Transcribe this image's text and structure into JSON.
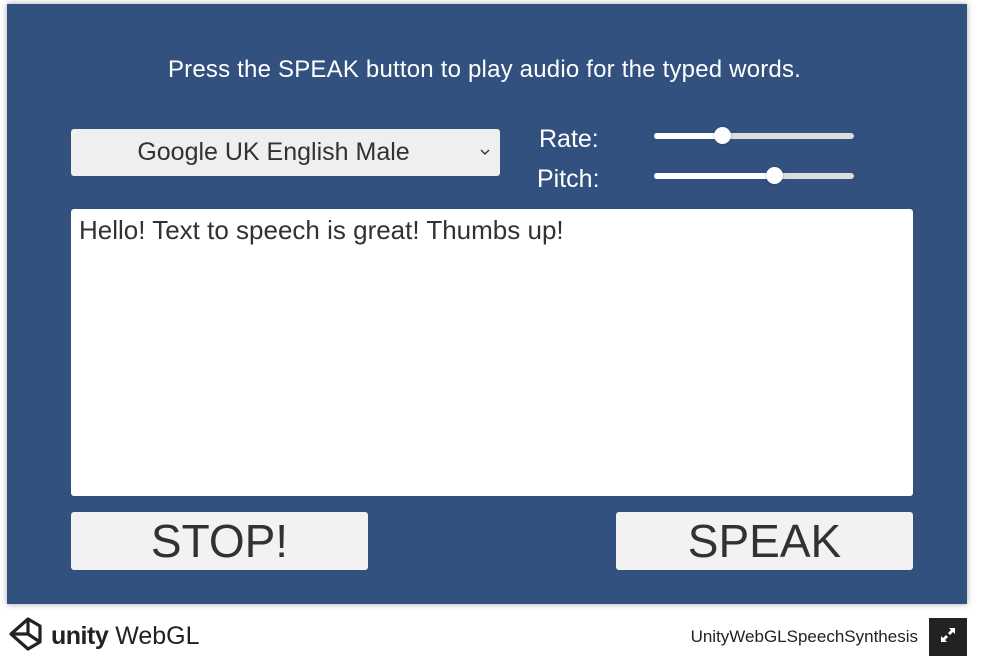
{
  "app": {
    "instructions": "Press the SPEAK button to play audio for the typed words.",
    "voice_select": {
      "selected": "Google UK English Male",
      "icon": "chevron-down-icon"
    },
    "rate": {
      "label": "Rate:",
      "value": 0.34
    },
    "pitch": {
      "label": "Pitch:",
      "value": 0.6
    },
    "text_input": {
      "value": "Hello! Text to speech is great! Thumbs up!"
    },
    "stop_label": "STOP!",
    "speak_label": "SPEAK",
    "background_color": "#33517f"
  },
  "footer": {
    "logo_unity": "unity",
    "logo_webgl": "WebGL",
    "title": "UnityWebGLSpeechSynthesis",
    "fullscreen_icon": "fullscreen-icon"
  }
}
